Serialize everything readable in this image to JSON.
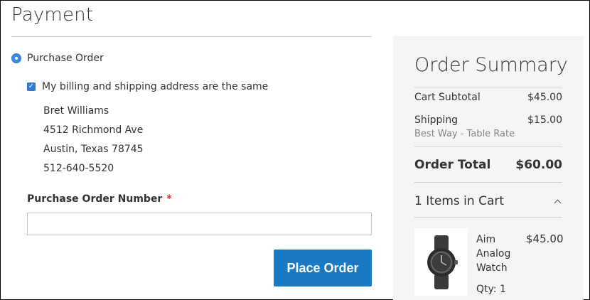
{
  "payment": {
    "title": "Payment",
    "method_label": "Purchase Order",
    "same_address_label": "My billing and shipping address are the same",
    "same_address_checked": true,
    "address": {
      "name": "Bret Williams",
      "street": "4512 Richmond Ave",
      "city_state_zip": "Austin, Texas 78745",
      "phone": "512-640-5520"
    },
    "po_number": {
      "label": "Purchase Order Number",
      "required_marker": "*",
      "value": "",
      "placeholder": ""
    },
    "place_order_label": "Place Order"
  },
  "summary": {
    "title": "Order Summary",
    "subtotal_label": "Cart Subtotal",
    "subtotal_value": "$45.00",
    "shipping_label": "Shipping",
    "shipping_value": "$15.00",
    "shipping_method": "Best Way - Table Rate",
    "total_label": "Order Total",
    "total_value": "$60.00",
    "cart_count_label": "1 Items in Cart",
    "items": [
      {
        "name_lines": [
          "Aim",
          "Analog",
          "Watch"
        ],
        "price": "$45.00",
        "qty_label": "Qty: 1",
        "thumbnail_icon": "watch-icon"
      }
    ]
  },
  "colors": {
    "accent": "#1979c3",
    "radio": "#3a8be0",
    "required": "#e02b27",
    "summary_bg": "#f5f5f5",
    "muted_text": "#858585"
  }
}
